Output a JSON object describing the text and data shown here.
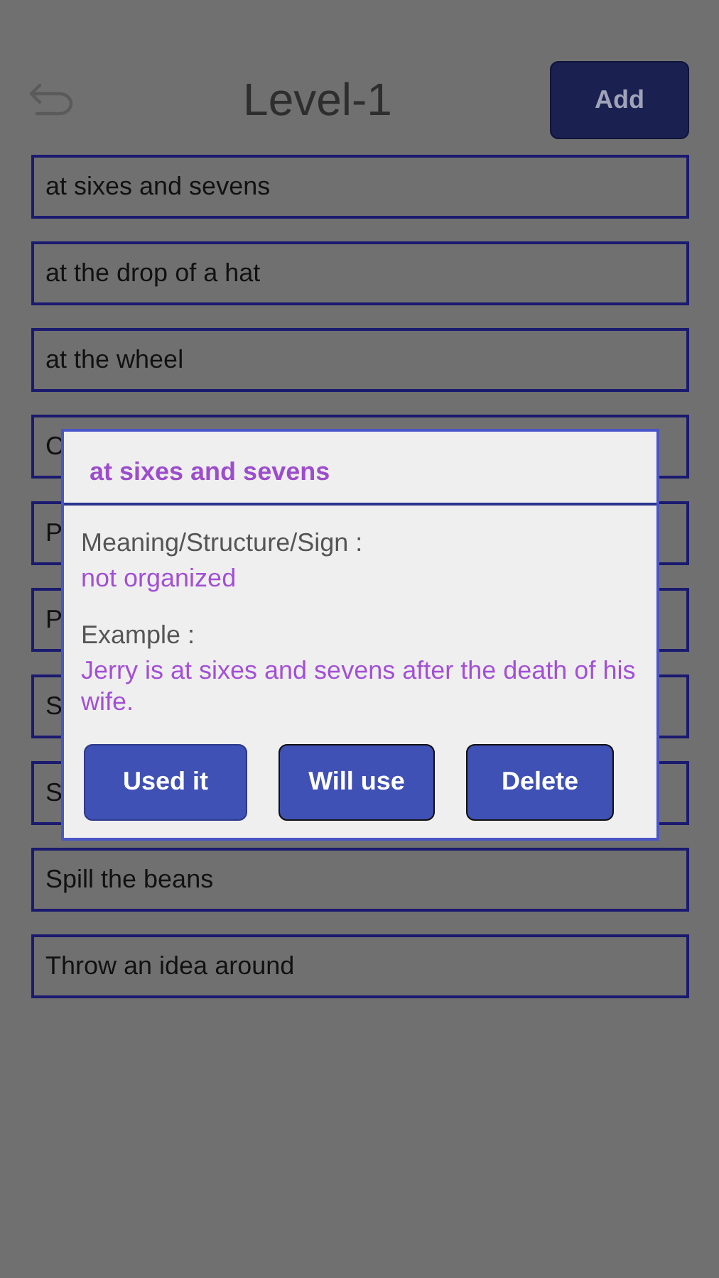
{
  "header": {
    "title": "Level-1",
    "add_button": "Add"
  },
  "items": [
    {
      "text": "at sixes and sevens"
    },
    {
      "text": "at the drop of a hat"
    },
    {
      "text": "at the wheel"
    },
    {
      "text": "C"
    },
    {
      "text": "P"
    },
    {
      "text": "P"
    },
    {
      "text": "S"
    },
    {
      "text": "S"
    },
    {
      "text": "Spill the beans"
    },
    {
      "text": "Throw an idea around"
    }
  ],
  "dialog": {
    "title": "at sixes and sevens",
    "meaning_label": "Meaning/Structure/Sign :",
    "meaning": "not organized",
    "example_label": "Example :",
    "example": "Jerry is at sixes and sevens after the death of his wife.",
    "buttons": [
      "Used it",
      "Will use",
      "Delete"
    ]
  }
}
